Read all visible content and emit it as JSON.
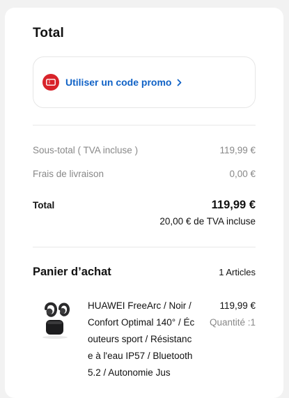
{
  "summary": {
    "title": "Total",
    "promo_label": "Utiliser un code promo",
    "subtotal_label": "Sous-total ( TVA incluse )",
    "subtotal_value": "119,99 €",
    "shipping_label": "Frais de livraison",
    "shipping_value": "0,00 €",
    "total_label": "Total",
    "total_value": "119,99 €",
    "vat_note": "20,00 € de TVA incluse"
  },
  "cart": {
    "title": "Panier d’achat",
    "count": "1 Articles",
    "items": [
      {
        "name": "HUAWEI FreeArc / Noir / Confort Optimal 140° / Écouteurs sport / Résistance à l'eau IP57 / Bluetooth 5.2 / Autonomie Jus",
        "price": "119,99 €",
        "quantity": "Quantité :1"
      }
    ]
  },
  "colors": {
    "accent_blue": "#1062c6",
    "promo_red": "#d8232a"
  },
  "icons": {
    "promo": "coupon-icon",
    "chevron": "chevron-right-icon"
  }
}
